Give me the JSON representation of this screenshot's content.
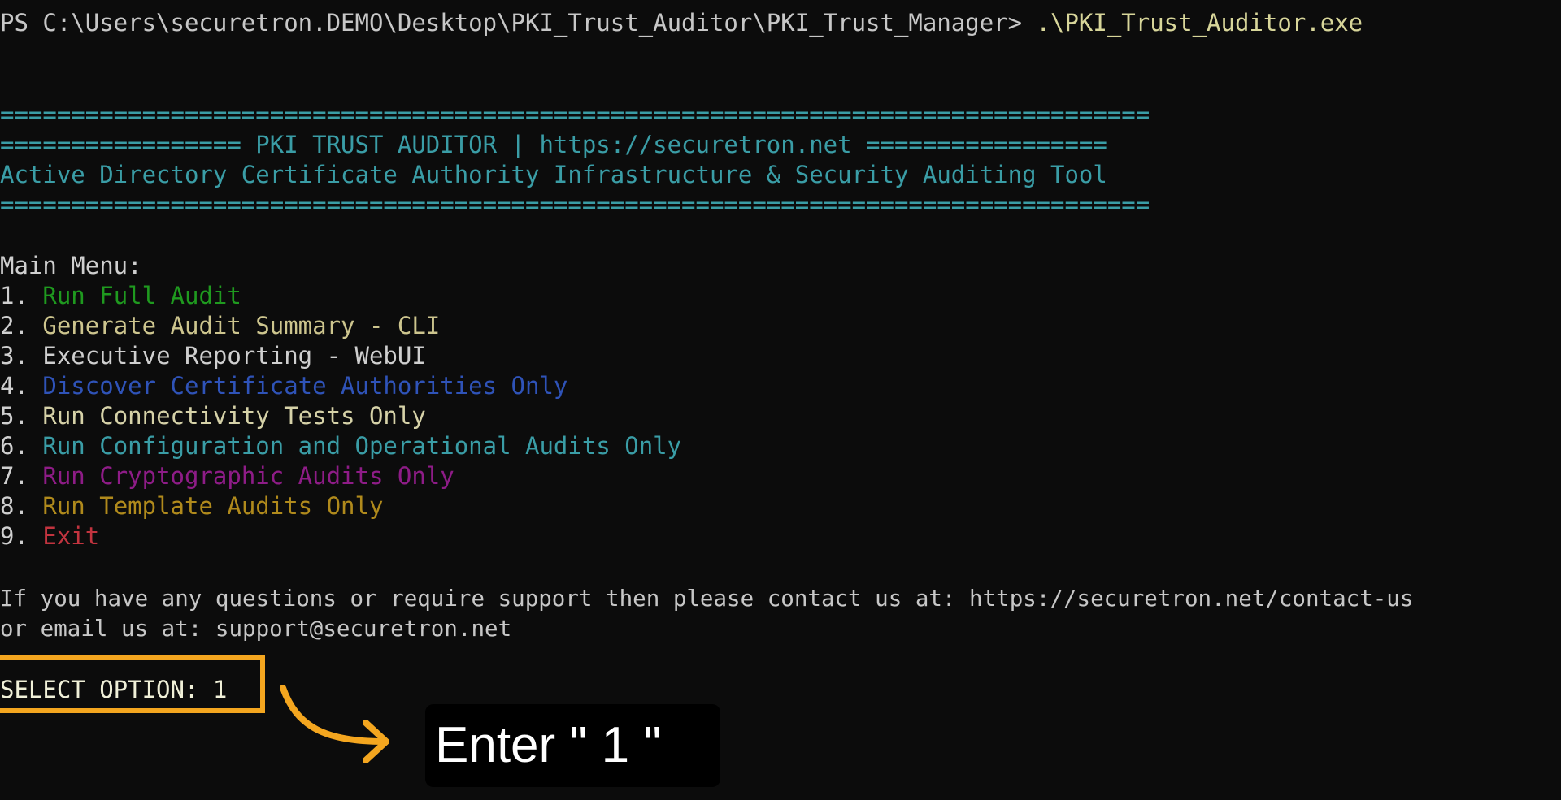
{
  "prompt": {
    "path": "PS C:\\Users\\securetron.DEMO\\Desktop\\PKI_Trust_Auditor\\PKI_Trust_Manager> ",
    "command": ".\\PKI_Trust_Auditor.exe"
  },
  "banner": {
    "rule": "=================================================================================",
    "title_line": "================= PKI TRUST AUDITOR | https://securetron.net =================",
    "subtitle": "Active Directory Certificate Authority Infrastructure & Security Auditing Tool"
  },
  "menu": {
    "title": "Main Menu:",
    "items": [
      {
        "num": "1. ",
        "label": "Run Full Audit",
        "color": "#1f9a1f"
      },
      {
        "num": "2. ",
        "label": "Generate Audit Summary - CLI",
        "color": "#cdc58e"
      },
      {
        "num": "3. ",
        "label": "Executive Reporting - WebUI",
        "color": "#cfcfcf"
      },
      {
        "num": "4. ",
        "label": "Discover Certificate Authorities Only",
        "color": "#2f53b8"
      },
      {
        "num": "5. ",
        "label": "Run Connectivity Tests Only",
        "color": "#d6d2a8"
      },
      {
        "num": "6. ",
        "label": "Run Configuration and Operational Audits Only",
        "color": "#3a9da6"
      },
      {
        "num": "7. ",
        "label": "Run Cryptographic Audits Only",
        "color": "#8e1c87"
      },
      {
        "num": "8. ",
        "label": "Run Template Audits Only",
        "color": "#b08a1c"
      },
      {
        "num": "9. ",
        "label": "Exit",
        "color": "#c2343f"
      }
    ]
  },
  "support": {
    "line1": "If you have any questions or require support then please contact us at: https://securetron.net/contact-us",
    "line2": "or email us at: support@securetron.net"
  },
  "input": {
    "text": "SELECT OPTION: 1"
  },
  "callout": {
    "text": "Enter \" 1 \""
  },
  "colors": {
    "highlight": "#f4a61f",
    "background": "#0c0c0c"
  }
}
